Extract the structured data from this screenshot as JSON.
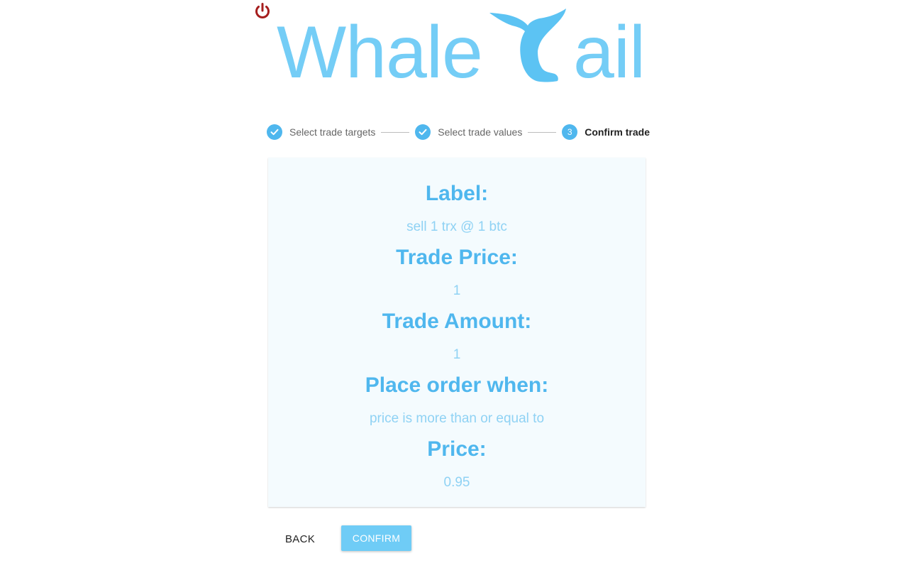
{
  "header": {
    "power_icon": "power-icon",
    "logo_word_left": "Whale",
    "logo_word_right": "ail",
    "logo_icon": "whale-tail-icon",
    "logo_color": "#74cdf6",
    "power_color": "#a51d1d"
  },
  "stepper": {
    "steps": [
      {
        "label": "Select trade targets",
        "state": "completed",
        "icon": "check-icon"
      },
      {
        "label": "Select trade values",
        "state": "completed",
        "icon": "check-icon"
      },
      {
        "label": "Confirm trade",
        "state": "active",
        "number": "3"
      }
    ]
  },
  "summary": {
    "fields": [
      {
        "label": "Label:",
        "value": "sell 1 trx @ 1 btc"
      },
      {
        "label": "Trade Price:",
        "value": "1"
      },
      {
        "label": "Trade Amount:",
        "value": "1"
      },
      {
        "label": "Place order when:",
        "value": "price is more than or equal to"
      },
      {
        "label": "Price:",
        "value": "0.95"
      }
    ]
  },
  "actions": {
    "back_label": "BACK",
    "confirm_label": "CONFIRM"
  },
  "colors": {
    "accent": "#4fb7ee",
    "button": "#6fccf6",
    "card_bg": "#f4fbfe"
  }
}
